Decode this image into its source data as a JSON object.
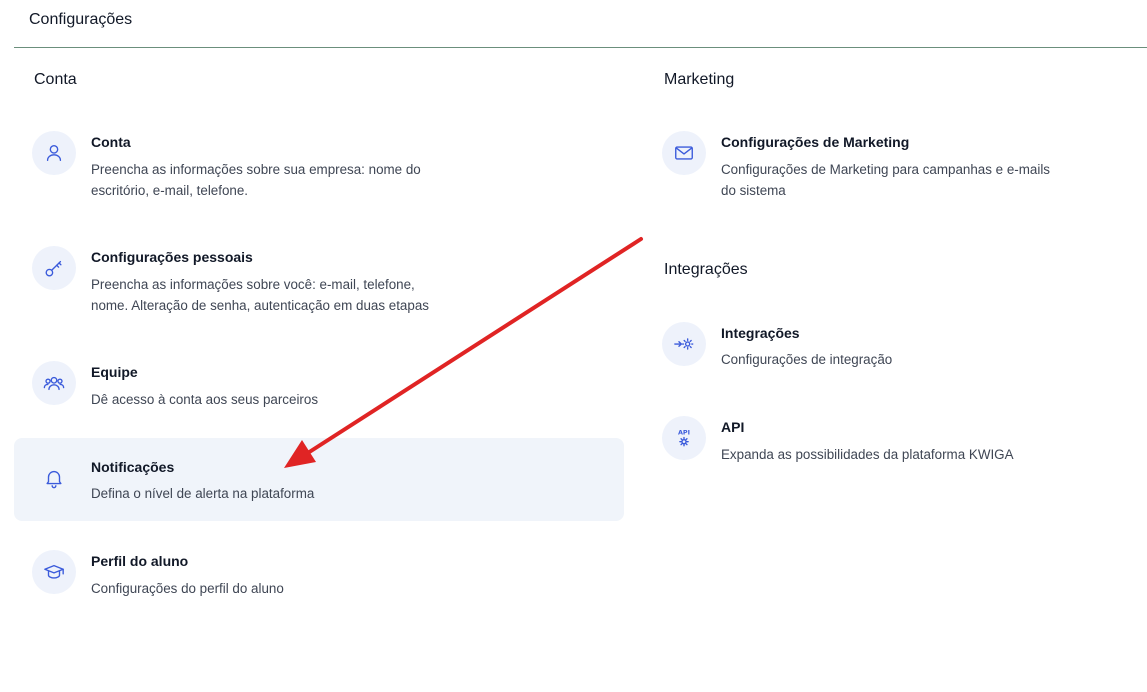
{
  "header": {
    "title": "Configurações"
  },
  "sections": {
    "conta": {
      "heading": "Conta",
      "items": [
        {
          "title": "Conta",
          "desc_lines": [
            "Preencha as informações sobre sua empresa: nome do",
            "escritório, e-mail, telefone."
          ],
          "icon": "user-icon"
        },
        {
          "title": "Configurações pessoais",
          "desc_lines": [
            "Preencha as informações sobre você: e-mail, telefone,",
            "nome. Alteração de senha, autenticação em duas etapas"
          ],
          "icon": "key-icon"
        },
        {
          "title": "Equipe",
          "desc_lines": [
            "Dê acesso à conta aos seus parceiros"
          ],
          "icon": "team-icon"
        },
        {
          "title": "Notificações",
          "desc_lines": [
            "Defina o nível de alerta na plataforma"
          ],
          "icon": "bell-icon"
        },
        {
          "title": "Perfil do aluno",
          "desc_lines": [
            "Configurações do perfil do aluno"
          ],
          "icon": "graduation-cap-icon"
        }
      ]
    },
    "marketing": {
      "heading": "Marketing",
      "items": [
        {
          "title": "Configurações de Marketing",
          "desc_lines": [
            "Configurações de Marketing para campanhas e e-mails",
            "do sistema"
          ],
          "icon": "mail-icon"
        }
      ]
    },
    "integracoes": {
      "heading": "Integrações",
      "items": [
        {
          "title": "Integrações",
          "desc_lines": [
            "Configurações de integração"
          ],
          "icon": "integration-gear-icon"
        },
        {
          "title": "API",
          "desc_lines": [
            "Expanda as possibilidades da plataforma KWIGA"
          ],
          "icon": "api-gear-icon"
        }
      ]
    }
  },
  "colors": {
    "accent": "#3b5bdb",
    "icon_bg": "#eef2fb",
    "highlight_bg": "#f0f4fa",
    "annotation_arrow": "#e02424"
  }
}
